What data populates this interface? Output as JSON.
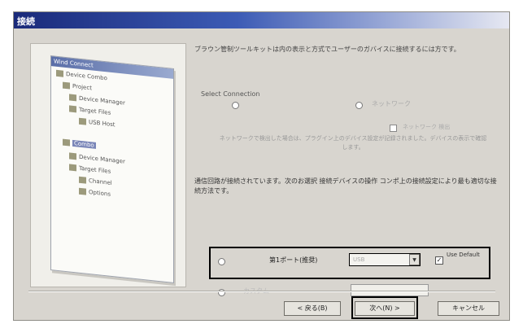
{
  "window": {
    "title": "接続"
  },
  "tree": {
    "header": "Wind Connect",
    "nodes": [
      "Device Combo",
      "Project",
      "Device Manager",
      "Target Files",
      "USB Host",
      "Combo",
      "Device Manager",
      "Target Files",
      "Channel",
      "Options"
    ]
  },
  "intro": "ブラウン管制ツールキットは内の表示と方式でユーザーのガバイスに接続するには方です。",
  "select_connection": {
    "label": "Select Connection",
    "option2_label": "ネットワーク"
  },
  "checkbox1": {
    "label": "ネットワーク 検出"
  },
  "note": "ネットワークで検出した場合は、プラグイン上のデバイス設定が記録されました。デバイスの表示で確認します。",
  "description": "通信回路が接続されています。次のお選択 接続デバイスの操作 コンポ上の接続設定により最も適切な接続方法です。",
  "row1": {
    "label": "第1ポート(推奨)",
    "combo_value": "USB",
    "checkbox_label": "Use Default"
  },
  "row2": {
    "label": "カスタム"
  },
  "buttons": {
    "back": "< 戻る(B)",
    "next": "次へ(N) >",
    "cancel": "キャンセル"
  }
}
